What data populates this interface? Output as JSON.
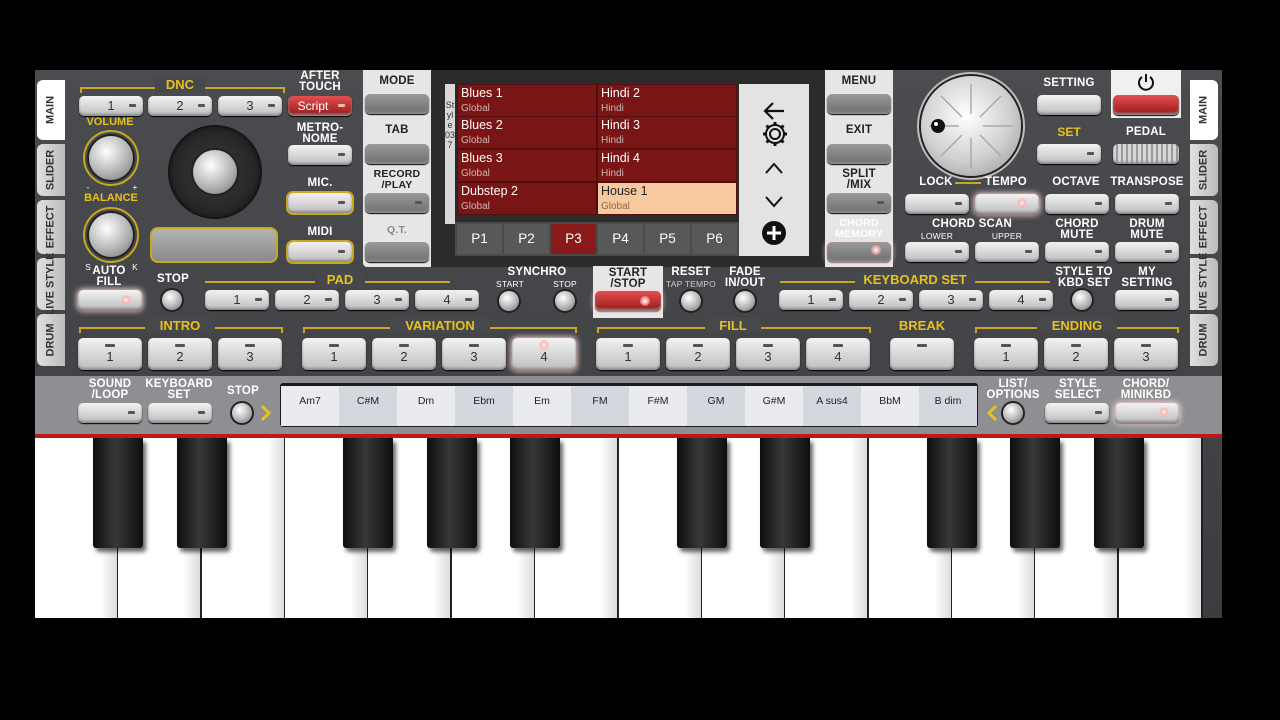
{
  "tabs_left": [
    "MAIN",
    "SLIDER",
    "EFFECT",
    "LIVE\nSTYLE",
    "DRUM"
  ],
  "tabs_right": [
    "MAIN",
    "SLIDER",
    "EFFECT",
    "LIVE\nSTYLE",
    "DRUM"
  ],
  "top_left": {
    "dnc_label": "DNC",
    "dnc_buttons": [
      "1",
      "2",
      "3"
    ],
    "after_touch_label": "AFTER\nTOUCH",
    "script_label": "Script",
    "volume_label": "VOLUME",
    "balance_label": "BALANCE",
    "metronome_label": "METRO-\nNOME",
    "mic_label": "MIC.",
    "midi_label": "MIDI",
    "vol_minus": "-",
    "vol_plus": "+",
    "bal_s": "S",
    "bal_k": "K"
  },
  "mid_left": {
    "mode_label": "MODE",
    "tab_label": "TAB",
    "record_label": "RECORD\n/PLAY",
    "qt_label": "Q.T."
  },
  "style_panel": {
    "side_label": "Style 037",
    "styles": [
      {
        "name": "Blues 1",
        "cat": "Global",
        "sel": false
      },
      {
        "name": "Hindi 2",
        "cat": "Hindi",
        "sel": false
      },
      {
        "name": "Blues 2",
        "cat": "Global",
        "sel": false
      },
      {
        "name": "Hindi 3",
        "cat": "Hindi",
        "sel": false
      },
      {
        "name": "Blues 3",
        "cat": "Global",
        "sel": false
      },
      {
        "name": "Hindi 4",
        "cat": "Hindi",
        "sel": false
      },
      {
        "name": "Dubstep 2",
        "cat": "Global",
        "sel": false
      },
      {
        "name": "House 1",
        "cat": "Global",
        "sel": true
      }
    ],
    "pages": [
      "P1",
      "P2",
      "P3",
      "P4",
      "P5",
      "P6"
    ],
    "selected_page": "P3"
  },
  "mid_right": {
    "menu_label": "MENU",
    "exit_label": "EXIT",
    "split_label": "SPLIT\n/MIX",
    "chord_memory_label": "CHORD\nMEMORY"
  },
  "top_right": {
    "setting_label": "SETTING",
    "set_label": "SET",
    "pedal_label": "PEDAL",
    "lock_label": "LOCK",
    "tempo_label": "TEMPO",
    "octave_label": "OCTAVE",
    "transpose_label": "TRANSPOSE",
    "chord_scan_label": "CHORD SCAN",
    "lower_label": "LOWER",
    "upper_label": "UPPER",
    "chord_mute_label": "CHORD\nMUTE",
    "drum_mute_label": "DRUM\nMUTE"
  },
  "row3": {
    "auto_fill_label": "AUTO\nFILL",
    "stop_label": "STOP",
    "pad_label": "PAD",
    "pad_buttons": [
      "1",
      "2",
      "3",
      "4"
    ],
    "synchro_label": "SYNCHRO",
    "synchro_start": "START",
    "synchro_stop": "STOP",
    "start_stop_label": "START\n/STOP",
    "reset_label": "RESET",
    "tap_tempo_label": "TAP TEMPO",
    "fade_label": "FADE\nIN/OUT",
    "keyboard_set_label": "KEYBOARD SET",
    "kbd_buttons": [
      "1",
      "2",
      "3",
      "4"
    ],
    "style_to_kbd_label": "STYLE TO\nKBD SET",
    "my_setting_label": "MY\nSETTING"
  },
  "row4": {
    "intro_label": "INTRO",
    "intro_buttons": [
      "1",
      "2",
      "3"
    ],
    "variation_label": "VARIATION",
    "variation_buttons": [
      "1",
      "2",
      "3",
      "4"
    ],
    "fill_label": "FILL",
    "fill_buttons": [
      "1",
      "2",
      "3",
      "4"
    ],
    "break_label": "BREAK",
    "ending_label": "ENDING",
    "ending_buttons": [
      "1",
      "2",
      "3"
    ]
  },
  "row5": {
    "sound_loop_label": "SOUND\n/LOOP",
    "keyboard_set_label": "KEYBOARD\nSET",
    "stop_label": "STOP",
    "chords": [
      "Am7",
      "C#M",
      "Dm",
      "Ebm",
      "Em",
      "FM",
      "F#M",
      "GM",
      "G#M",
      "A sus4",
      "BbM",
      "B dim"
    ],
    "list_options_label": "LIST/\nOPTIONS",
    "style_select_label": "STYLE\nSELECT",
    "chord_minikbd_label": "CHORD/\nMINIKBD"
  },
  "colors": {
    "gold": "#e8c21a",
    "panel_bg": "#44464a",
    "style_cell": "#7a1515",
    "style_selected": "#f6c99e"
  }
}
